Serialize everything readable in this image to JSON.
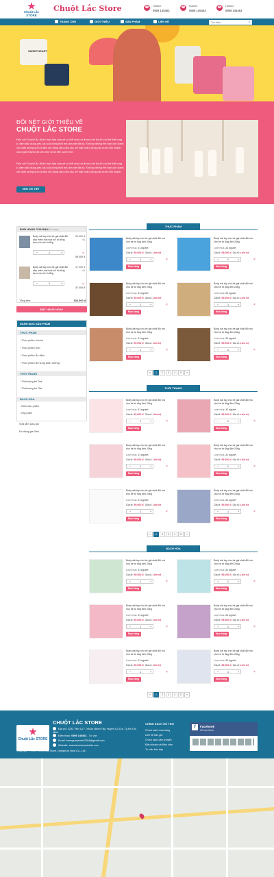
{
  "header": {
    "logo_text": "Chuột Lắc STORE",
    "brand": "Chuột Lắc Store",
    "hotlines": [
      {
        "label": "Hotline",
        "number": "0909 145463"
      },
      {
        "label": "Hotline",
        "number": "0909 145463"
      },
      {
        "label": "Hotline",
        "number": "0909 145463"
      }
    ]
  },
  "nav": {
    "items": [
      "TRANG CHỦ",
      "GIỚI THIỆU",
      "SẢN PHẨM",
      "LIÊN HỆ"
    ],
    "search_placeholder": "Tìm kiếm"
  },
  "banner": {
    "shirt_text": "SWEETHEART"
  },
  "about": {
    "kicker": "ĐÔI NÉT GIỚI THIỆU VỀ",
    "title": "CHUỘT LẮC STORE",
    "p1": "Đến với Chuột Lắc Store bạn đầy, ban sẽ có thể chọn ra được một bộ đồ cho bé thật ưng ý, đảm bảo đúng yêu cầu của từng thời mà cha mẹ đặt ra. Không những thế bạn còn được với chất lượng luôn là tiêu chí hàng đầu cửa các chỉ mãi chất lượng của nước lẫn khách của người được đồ cho nhé cổ là bên cạnh nhé.",
    "p2": "Đến với Chuột Lắc Store bạn đầy, ban sẽ có thể chọn ra được một bộ đồ cho bé thật ưng ý, đảm bảo đúng yêu cầu của từng thời mà cha mẹ đặt ra. Không những thế bạn còn được với chất lượng luôn là tiêu chí hàng đầu cửa các chỉ mãi chất lượng của nước lẫn khách.",
    "button": "XEM CHI TIẾT"
  },
  "cart": {
    "title": "ĐƠN HÀNG CỦA BẠN",
    "count": "(2 món)",
    "items": [
      {
        "name": "Body dài tay cho bé gái chất đũi sắp miền mai hoá nở hồ lông kem cho bé từ 8kg",
        "unit": "59.000 đ",
        "x": "x1",
        "qty": "1",
        "total": "59.000 đ"
      },
      {
        "name": "Body dài tay cho bé gái chất đũi sắp miền mai hoá nở hồ lông kem cho bé từ 8kg",
        "unit": "47.000 đ",
        "x": "x1",
        "qty": "1",
        "total": "47.000 đ"
      }
    ],
    "total_label": "Tổng tiền:",
    "total_value": "106.000 đ",
    "order_button": "ĐẶT HÀNG NGAY"
  },
  "categories": {
    "title": "DANH MỤC SẢN PHẨM",
    "groups": [
      {
        "name": "THỰC PHẨM",
        "items": [
          "Thực phẩm cho bé",
          "Thực phẩm Khô",
          "Thực phẩm Ăn dặm",
          "Thực phẩm Bổ sung Dinh dưỡng"
        ]
      },
      {
        "name": "THỜI TRANG",
        "items": [
          "Thời trang bé Trai",
          "Thời trang bé Gái"
        ]
      },
      {
        "name": "BÁCH HÓA",
        "items": [
          "Bình bảo phẩm",
          "Mỹ phẩm",
          "Sữa tắm Dầu gội",
          "Đồ dùng gia đình"
        ]
      }
    ]
  },
  "product": {
    "name": "Body dài tay cho bé gái chất đũi mù cho bé từ 6kg đến 20kg",
    "sold_label": "Lượt mua:",
    "sold_value": "21 người",
    "price_label": "Giá lẻ:",
    "price": "59.000 đ",
    "wholesale_label": "Giá sỉ:",
    "wholesale": "Liên hệ",
    "buy": "Mua hàng",
    "minus": "−",
    "qty": "1",
    "plus": "+",
    "remove": "×"
  },
  "sections": [
    "THỰC PHẨM",
    "THỜI TRANG",
    "BÁCH HÓA"
  ],
  "pagination": [
    "«",
    "1",
    "2",
    "3",
    "4",
    "5",
    "»"
  ],
  "footer": {
    "title": "CHUỘT LẮC STORE",
    "address": "Địa chỉ: 2232 Tỉnh Lộ 7, Xã An Nhơn Tây, Huyện Củ Chi, Tp.Hồ Chí Minh",
    "phone_label": "Điện thoại:",
    "phone": "0909 145463",
    "phone_suffix": "- Tư vấn",
    "email": "Email: tranngueyenthu2384@gmail.com",
    "website": "Website: www.tenmienwebsite.com",
    "policy_title": "CHÍNH SÁCH HỖ TRỢ",
    "policies": [
      "Chính sách mua hàng",
      "Liên hệ bán giá",
      "Chính sách vận chuyển",
      "Điều khoản và Điều kiện",
      "Tư vấn bán đạp"
    ],
    "fanpage": "Facebook",
    "fanpage_likes": "20 lượt thích",
    "copyright": "Copyright © 2021 Chuột Lắc Store. Design by Nina Co., Ltd."
  },
  "colors": {
    "primary": "#1c7196",
    "accent": "#ee5b7c",
    "price": "#d63a62"
  }
}
